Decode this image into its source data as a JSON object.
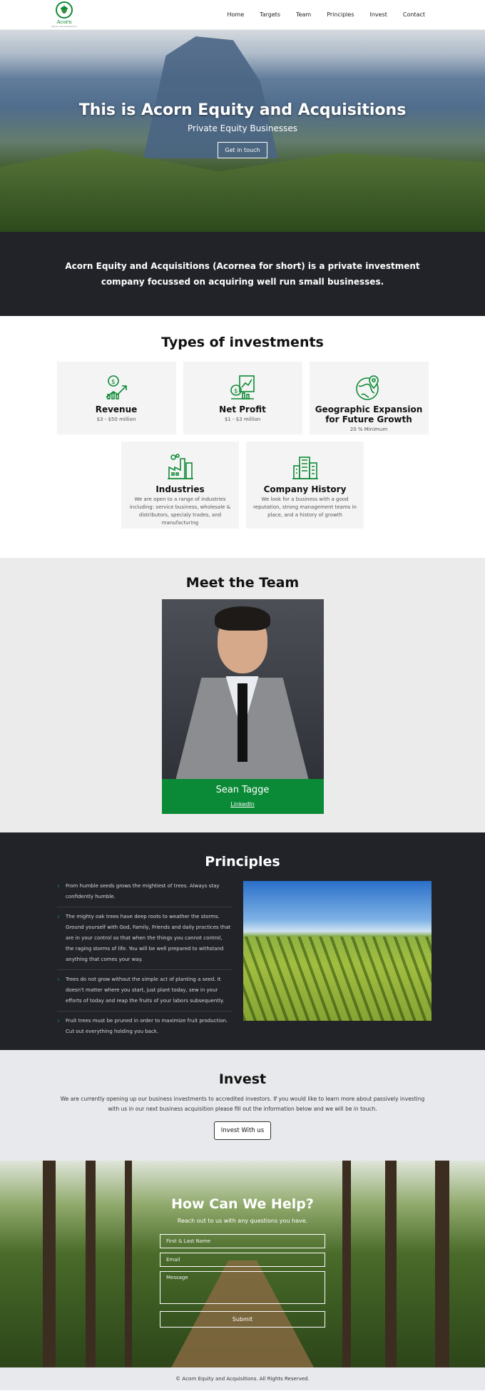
{
  "nav": {
    "logo_text": "Acorn",
    "logo_sub": "Equity and Acquisitions",
    "items": [
      "Home",
      "Targets",
      "Team",
      "Principles",
      "Invest",
      "Contact"
    ]
  },
  "hero": {
    "title": "This is Acorn Equity and Acquisitions",
    "subtitle": "Private Equity Businesses",
    "cta": "Get in touch"
  },
  "intro": {
    "text": "Acorn Equity and Acquisitions (Acornea for short) is a private investment company focussed on acquiring well run small businesses."
  },
  "types": {
    "title": "Types of investments",
    "cards": [
      {
        "title": "Revenue",
        "desc": "$3 - $50 million",
        "icon": "money-growth-icon"
      },
      {
        "title": "Net Profit",
        "desc": "$1 - $3 million",
        "icon": "profit-chart-icon"
      },
      {
        "title": "Geographic Expansion for Future Growth",
        "desc": "20 % Minimum",
        "icon": "globe-pin-icon"
      },
      {
        "title": "Industries",
        "desc": "We are open to a range of industries including: service business, wholesale & distributors, specialy trades, and manufacturing",
        "icon": "factory-icon"
      },
      {
        "title": "Company History",
        "desc": "We look for a business with a good reputation, strong management teams in place, and a history of growth",
        "icon": "building-icon"
      }
    ]
  },
  "team": {
    "title": "Meet the Team",
    "member_name": "Sean Tagge",
    "member_link": "LinkedIn"
  },
  "principles": {
    "title": "Principles",
    "items": [
      "From humble seeds grows the mightiest of trees. Always stay confidently humble.",
      "The mighty oak trees have deep roots to weather the storms. Ground yourself with God, Family, Friends and daily practices that are in your control so that when the things you cannot control, the raging storms of life. You will be well prepared to withstand anything that comes your way.",
      "Trees do not grow without the simple act of planting a seed. It doesn't matter where you start, just plant today, sew in your efforts of today and reap the fruits of your labors subsequently.",
      "Fruit trees must be pruned in order to maximize fruit production. Cut out everything holding you back."
    ]
  },
  "invest": {
    "title": "Invest",
    "text": "We are currently opening up our business investments to accredited investors. If you would like to learn more about passively investing with us in our next business acquisition please fill out the information below and we will be in touch.",
    "button": "Invest With us"
  },
  "contact": {
    "title": "How Can We Help?",
    "subtitle": "Reach out to us with any questions you have.",
    "name_placeholder": "First & Last Name",
    "email_placeholder": "Email",
    "message_placeholder": "Message",
    "submit": "Submit"
  },
  "footer": {
    "text": "© Acorn Equity and Acquisitions. All Rights Reserved."
  },
  "colors": {
    "brand_green": "#0a8a36",
    "dark_bg": "#212329"
  }
}
